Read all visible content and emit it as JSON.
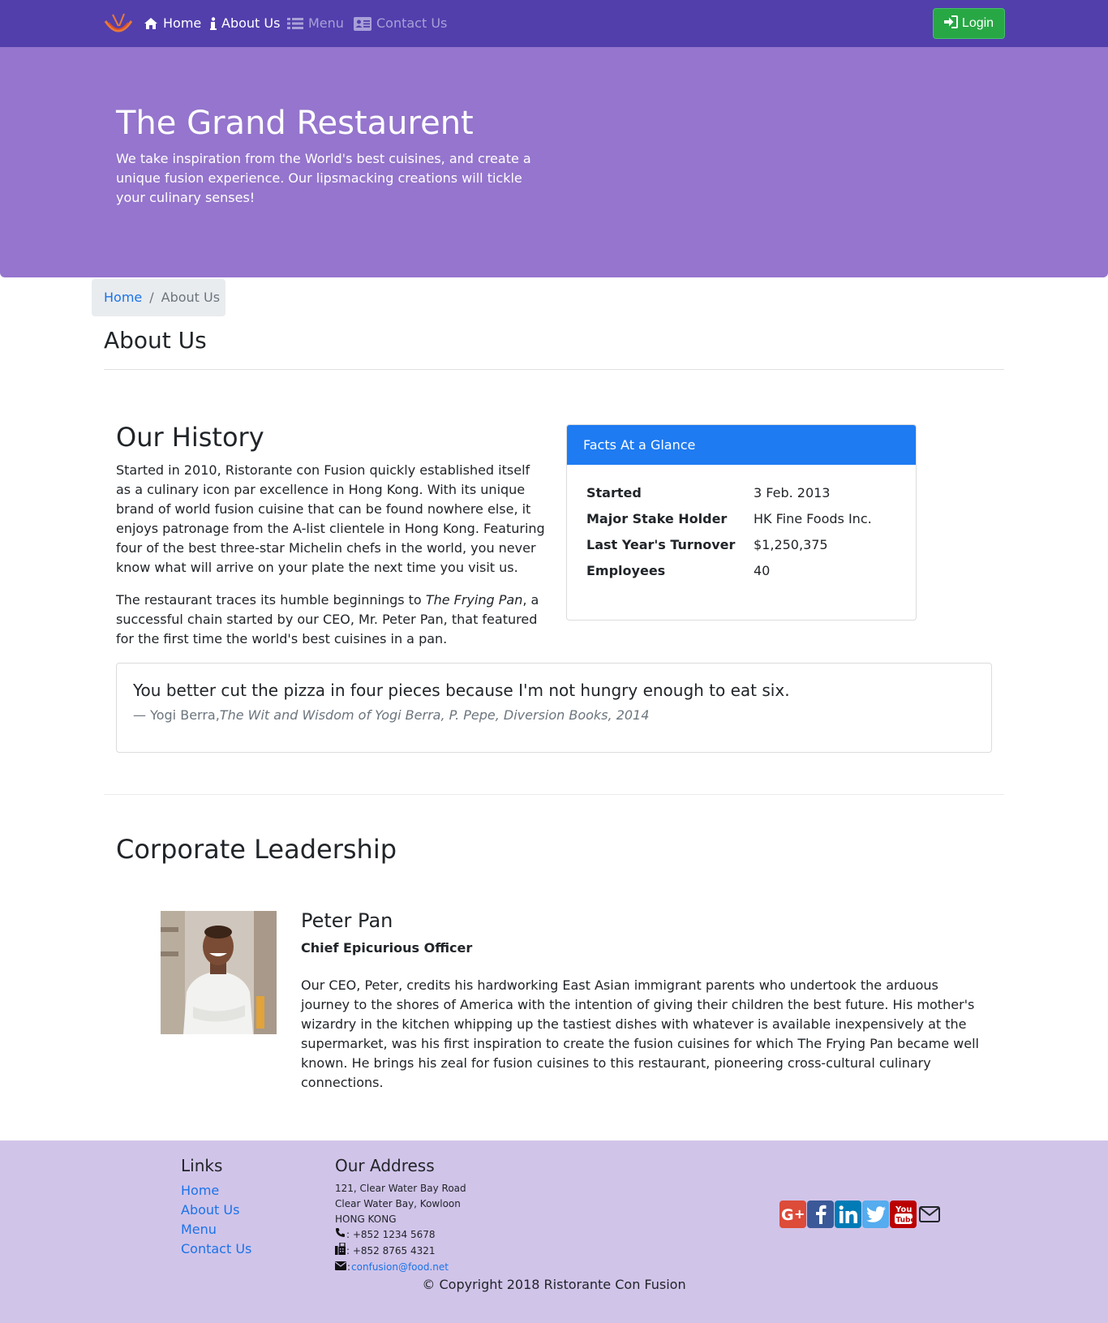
{
  "colors": {
    "navbar": "#523fac",
    "jumbotron": "#9575cd",
    "footer": "#d1c4e9",
    "card_header": "#1e7bf2",
    "login": "#28a745",
    "link": "#1a73e8"
  },
  "nav": {
    "items": [
      {
        "label": "Home",
        "icon": "home-icon"
      },
      {
        "label": "About Us",
        "icon": "info-icon"
      },
      {
        "label": "Menu",
        "icon": "list-icon"
      },
      {
        "label": "Contact Us",
        "icon": "address-card-icon"
      }
    ],
    "login_label": "Login",
    "login_icon": "sign-in-icon",
    "logo_icon": "restaurant-logo-icon"
  },
  "jumbotron": {
    "title": "The Grand Restaurent",
    "text": "We take inspiration from the World's best cuisines, and create a unique fusion experience. Our lipsmacking creations will tickle your culinary senses!"
  },
  "breadcrumb": {
    "home": "Home",
    "separator": "/",
    "current": "About Us"
  },
  "page_title": "About Us",
  "history": {
    "heading": "Our History",
    "p1": "Started in 2010, Ristorante con Fusion quickly established itself as a culinary icon par excellence in Hong Kong. With its unique brand of world fusion cuisine that can be found nowhere else, it enjoys patronage from the A-list clientele in Hong Kong. Featuring four of the best three-star Michelin chefs in the world, you never know what will arrive on your plate the next time you visit us.",
    "p2_before": "The restaurant traces its humble beginnings to ",
    "p2_em": "The Frying Pan",
    "p2_after": ", a successful chain started by our CEO, Mr. Peter Pan, that featured for the first time the world's best cuisines in a pan."
  },
  "facts": {
    "header": "Facts At a Glance",
    "rows": [
      {
        "label": "Started",
        "value": "3 Feb. 2013"
      },
      {
        "label": "Major Stake Holder",
        "value": "HK Fine Foods Inc."
      },
      {
        "label": "Last Year's Turnover",
        "value": "$1,250,375"
      },
      {
        "label": "Employees",
        "value": "40"
      }
    ]
  },
  "quote": {
    "text": "You better cut the pizza in four pieces because I'm not hungry enough to eat six.",
    "author": "— Yogi Berra,",
    "source": "The Wit and Wisdom of Yogi Berra, P. Pepe, Diversion Books, 2014"
  },
  "leadership": {
    "heading": "Corporate Leadership",
    "name": "Peter Pan",
    "role": "Chief Epicurious Officer",
    "bio": "Our CEO, Peter, credits his hardworking East Asian immigrant parents who undertook the arduous journey to the shores of America with the intention of giving their children the best future. His mother's wizardry in the kitchen whipping up the tastiest dishes with whatever is available inexpensively at the supermarket, was his first inspiration to create the fusion cuisines for which The Frying Pan became well known. He brings his zeal for fusion cuisines to this restaurant, pioneering cross-cultural culinary connections."
  },
  "footer": {
    "links_heading": "Links",
    "links": [
      "Home",
      "About Us",
      "Menu",
      "Contact Us"
    ],
    "address_heading": "Our Address",
    "address_lines": [
      "121, Clear Water Bay Road",
      "Clear Water Bay, Kowloon",
      "HONG KONG"
    ],
    "phone": ": +852 1234 5678",
    "fax": ": +852 8765 4321",
    "email_prefix": ": ",
    "email": "confusion@food.net",
    "social": [
      {
        "icon": "google-plus-icon",
        "color": "#dd4b39"
      },
      {
        "icon": "facebook-icon",
        "color": "#3b5998"
      },
      {
        "icon": "linkedin-icon",
        "color": "#007bb6"
      },
      {
        "icon": "twitter-icon",
        "color": "#55acee"
      },
      {
        "icon": "youtube-icon",
        "color": "#bb0000"
      },
      {
        "icon": "mail-icon",
        "color": "#212529"
      }
    ],
    "copyright": "© Copyright 2018 Ristorante Con Fusion"
  }
}
